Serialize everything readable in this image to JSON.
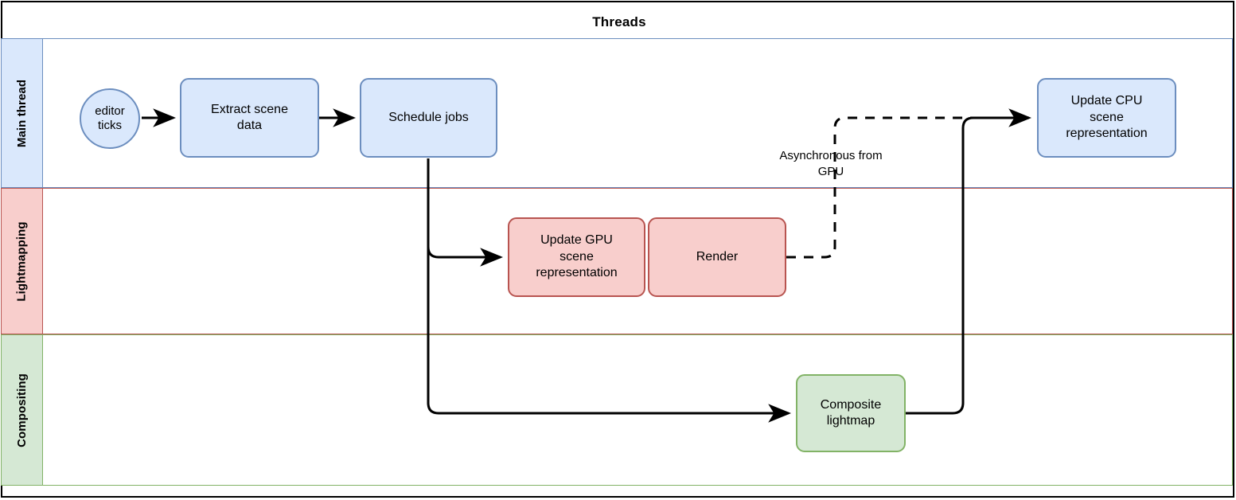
{
  "diagram": {
    "pool_title": "Threads",
    "lanes": [
      {
        "id": "main-thread",
        "label": "Main thread"
      },
      {
        "id": "lightmapping",
        "label": "Lightmapping"
      },
      {
        "id": "compositing",
        "label": "Compositing"
      }
    ],
    "nodes": [
      {
        "id": "editor-ticks",
        "label": "editor\nticks",
        "lane": "main-thread",
        "shape": "circle",
        "color": "blue"
      },
      {
        "id": "extract-scene-data",
        "label": "Extract scene\ndata",
        "lane": "main-thread",
        "shape": "rect",
        "color": "blue"
      },
      {
        "id": "schedule-jobs",
        "label": "Schedule jobs",
        "lane": "main-thread",
        "shape": "rect",
        "color": "blue"
      },
      {
        "id": "update-cpu-scene",
        "label": "Update CPU\nscene\nrepresentation",
        "lane": "main-thread",
        "shape": "rect",
        "color": "blue"
      },
      {
        "id": "update-gpu-scene",
        "label": "Update GPU\nscene\nrepresentation",
        "lane": "lightmapping",
        "shape": "rect",
        "color": "red"
      },
      {
        "id": "render",
        "label": "Render",
        "lane": "lightmapping",
        "shape": "rect",
        "color": "red"
      },
      {
        "id": "composite-lightmap",
        "label": "Composite\nlightmap",
        "lane": "compositing",
        "shape": "rect",
        "color": "green"
      }
    ],
    "edge_labels": [
      {
        "id": "async-from-gpu",
        "label": "Asynchronous from\nGPU"
      }
    ],
    "colors": {
      "blue_fill": "#dae8fc",
      "blue_stroke": "#6c8ebf",
      "red_fill": "#f8cecc",
      "red_stroke": "#b85450",
      "green_fill": "#d5e8d4",
      "green_stroke": "#82b366",
      "edge_stroke": "#000000",
      "frame_stroke": "#000000",
      "background": "#ffffff"
    }
  }
}
